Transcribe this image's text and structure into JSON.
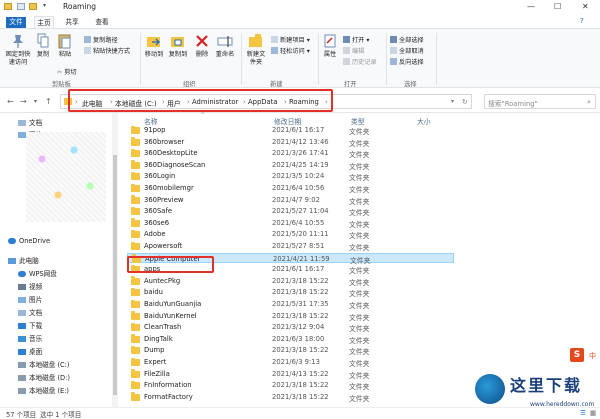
{
  "window": {
    "title": "Roaming",
    "controls": [
      "—",
      "☐",
      "✕"
    ]
  },
  "tabs": [
    "文件",
    "主页",
    "共享",
    "查看"
  ],
  "ribbon": {
    "clipboard": {
      "pin": "固定到快速访问",
      "copy": "复制",
      "paste": "粘贴",
      "copy_path": "复制路径",
      "paste_shortcut": "粘贴快捷方式",
      "cut": "剪切",
      "group": "剪贴板"
    },
    "organize": {
      "move_to": "移动到",
      "copy_to": "复制到",
      "delete": "删除",
      "rename": "重命名",
      "group": "组织"
    },
    "new": {
      "new_folder": "新建文件夹",
      "new_item": "新建项目 ▾",
      "easy_access": "轻松访问 ▾",
      "group": "新建"
    },
    "open": {
      "properties": "属性",
      "open": "打开 ▾",
      "edit": "编辑",
      "history": "历史记录",
      "group": "打开"
    },
    "select": {
      "select_all": "全部选择",
      "select_none": "全部取消",
      "invert": "反向选择",
      "group": "选择"
    }
  },
  "address": {
    "crumbs": [
      "此电脑",
      "本地磁盘 (C:)",
      "用户",
      "Administrator",
      "AppData",
      "Roaming"
    ],
    "search_placeholder": "搜索\"Roaming\""
  },
  "nav_pane": {
    "quick": [
      "文档",
      "图片"
    ],
    "onedrive": "OneDrive",
    "this_pc": "此电脑",
    "pc_items": [
      "WPS网盘",
      "视频",
      "图片",
      "文档",
      "下载",
      "音乐",
      "桌面",
      "本地磁盘 (C:)",
      "本地磁盘 (D:)",
      "本地磁盘 (E:)"
    ]
  },
  "columns": {
    "name": "名称",
    "date": "修改日期",
    "type": "类型",
    "size": "大小"
  },
  "files": [
    {
      "name": "91pop",
      "date": "2021/6/1 16:17",
      "type": "文件夹"
    },
    {
      "name": "360browser",
      "date": "2021/4/12 13:46",
      "type": "文件夹"
    },
    {
      "name": "360DesktopLite",
      "date": "2021/3/26 17:41",
      "type": "文件夹"
    },
    {
      "name": "360DiagnoseScan",
      "date": "2021/4/25 14:19",
      "type": "文件夹"
    },
    {
      "name": "360Login",
      "date": "2021/3/5 10:24",
      "type": "文件夹"
    },
    {
      "name": "360mobilemgr",
      "date": "2021/6/4 10:56",
      "type": "文件夹"
    },
    {
      "name": "360Preview",
      "date": "2021/4/7 9:02",
      "type": "文件夹"
    },
    {
      "name": "360Safe",
      "date": "2021/5/27 11:04",
      "type": "文件夹"
    },
    {
      "name": "360se6",
      "date": "2021/6/4 10:55",
      "type": "文件夹"
    },
    {
      "name": "Adobe",
      "date": "2021/5/20 11:11",
      "type": "文件夹"
    },
    {
      "name": "Apowersoft",
      "date": "2021/5/27 8:51",
      "type": "文件夹"
    },
    {
      "name": "Apple Computer",
      "date": "2021/4/21 11:59",
      "type": "文件夹",
      "selected": true
    },
    {
      "name": "apps",
      "date": "2021/6/1 16:17",
      "type": "文件夹"
    },
    {
      "name": "AuntecPkg",
      "date": "2021/3/18 15:22",
      "type": "文件夹"
    },
    {
      "name": "baidu",
      "date": "2021/3/18 15:22",
      "type": "文件夹"
    },
    {
      "name": "BaiduYunGuanjia",
      "date": "2021/5/31 17:35",
      "type": "文件夹"
    },
    {
      "name": "BaiduYunKernel",
      "date": "2021/3/18 15:22",
      "type": "文件夹"
    },
    {
      "name": "CleanTrash",
      "date": "2021/3/12 9:04",
      "type": "文件夹"
    },
    {
      "name": "DingTalk",
      "date": "2021/6/3 18:00",
      "type": "文件夹"
    },
    {
      "name": "Dump",
      "date": "2021/3/18 15:22",
      "type": "文件夹"
    },
    {
      "name": "Expert",
      "date": "2021/6/3 9:13",
      "type": "文件夹"
    },
    {
      "name": "FileZilla",
      "date": "2021/4/13 15:22",
      "type": "文件夹"
    },
    {
      "name": "FnInformation",
      "date": "2021/3/18 15:22",
      "type": "文件夹"
    },
    {
      "name": "FormatFactory",
      "date": "2021/3/18 15:22",
      "type": "文件夹"
    }
  ],
  "status": {
    "count": "57 个项目",
    "selected": "选中 1 个项目"
  },
  "watermark": {
    "text": "这里下载",
    "url": "www.hereddown.com",
    "ime": "S",
    "ime_label": "中"
  }
}
